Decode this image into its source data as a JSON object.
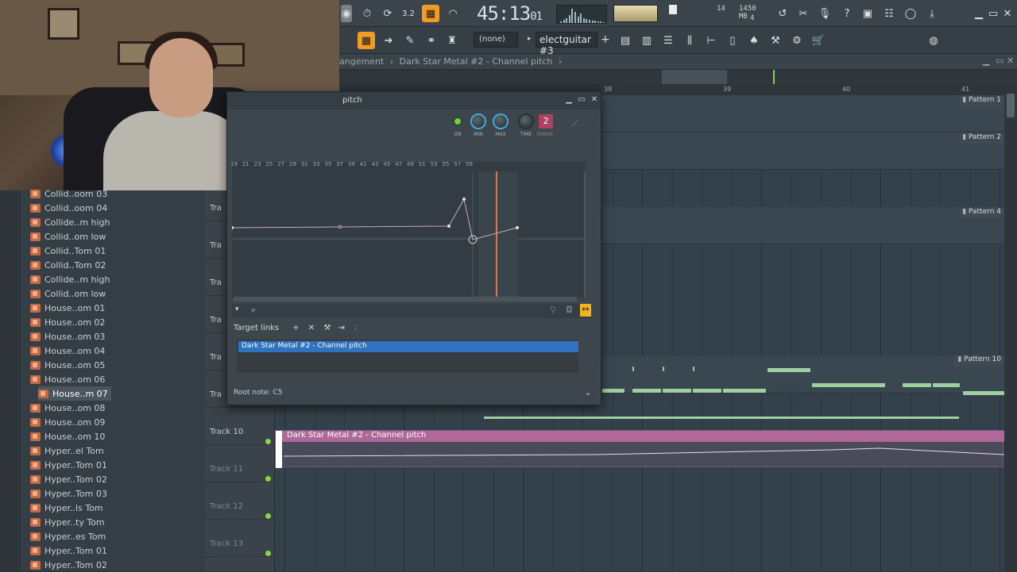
{
  "toolbar": {
    "time": "45:13",
    "time_sub": "01",
    "cpu_value": "14",
    "memory": "1450 MB",
    "polyphony": "4",
    "pattern_select": "(none)",
    "track_name": "electguitar #3",
    "add_label": "+"
  },
  "breadcrumb": {
    "left": "angement",
    "sep": "›",
    "path": "Dark Star Metal #2 - Channel pitch",
    "end": "›"
  },
  "ruler": [
    "38",
    "39",
    "40",
    "41"
  ],
  "browser": {
    "items": [
      "Collid..oom 03",
      "Collid..oom 04",
      "Collide..m high",
      "Collid..om low",
      "Collid..Tom 01",
      "Collid..Tom 02",
      "Collide..m high",
      "Collid..om low",
      "House..om 01",
      "House..om 02",
      "House..om 03",
      "House..om 04",
      "House..om 05",
      "House..om 06",
      "House..m 07",
      "House..om 08",
      "House..om 09",
      "House..om 10",
      "Hyper..el Tom",
      "Hyper..Tom 01",
      "Hyper..Tom 02",
      "Hyper..Tom 03",
      "Hyper..ls Tom",
      "Hyper..ty Tom",
      "Hyper..es Tom",
      "Hyper..Tom 01",
      "Hyper..Tom 02"
    ],
    "selected_index": 14
  },
  "tracks": [
    {
      "label": "Tra",
      "dim": false
    },
    {
      "label": "Tra",
      "dim": false
    },
    {
      "label": "Tra",
      "dim": false
    },
    {
      "label": "Tra",
      "dim": false
    },
    {
      "label": "Tra",
      "dim": false
    },
    {
      "label": "Tra",
      "dim": false
    },
    {
      "label": "Track 10",
      "dim": false
    },
    {
      "label": "Track 11",
      "dim": true
    },
    {
      "label": "Track 12",
      "dim": true
    },
    {
      "label": "Track 13",
      "dim": true
    }
  ],
  "patterns": {
    "p1": "Pattern 1",
    "p2": "Pattern 2",
    "p4": "Pattern 4",
    "p10": "Pattern 10"
  },
  "auto_clip": {
    "title": "Dark Star Metal #2 - Channel pitch"
  },
  "auto_window": {
    "title": "pitch",
    "knobs": {
      "on": "ON",
      "min": "MIN",
      "max": "MAX",
      "time": "TIME",
      "range": "RANGE",
      "range_value": "2"
    },
    "ruler": [
      "19",
      "21",
      "23",
      "25",
      "27",
      "29",
      "31",
      "33",
      "35",
      "37",
      "39",
      "41",
      "43",
      "45",
      "47",
      "49",
      "51",
      "53",
      "55",
      "57",
      "59"
    ],
    "target_links_label": "Target links",
    "target_item": "Dark Star Metal #2 - Channel pitch",
    "root_note": "Root note: C5"
  },
  "colors": {
    "accent": "#f29b24",
    "selection": "#2f72c0",
    "clip": "#b06898",
    "playhead": "#e8704a"
  }
}
